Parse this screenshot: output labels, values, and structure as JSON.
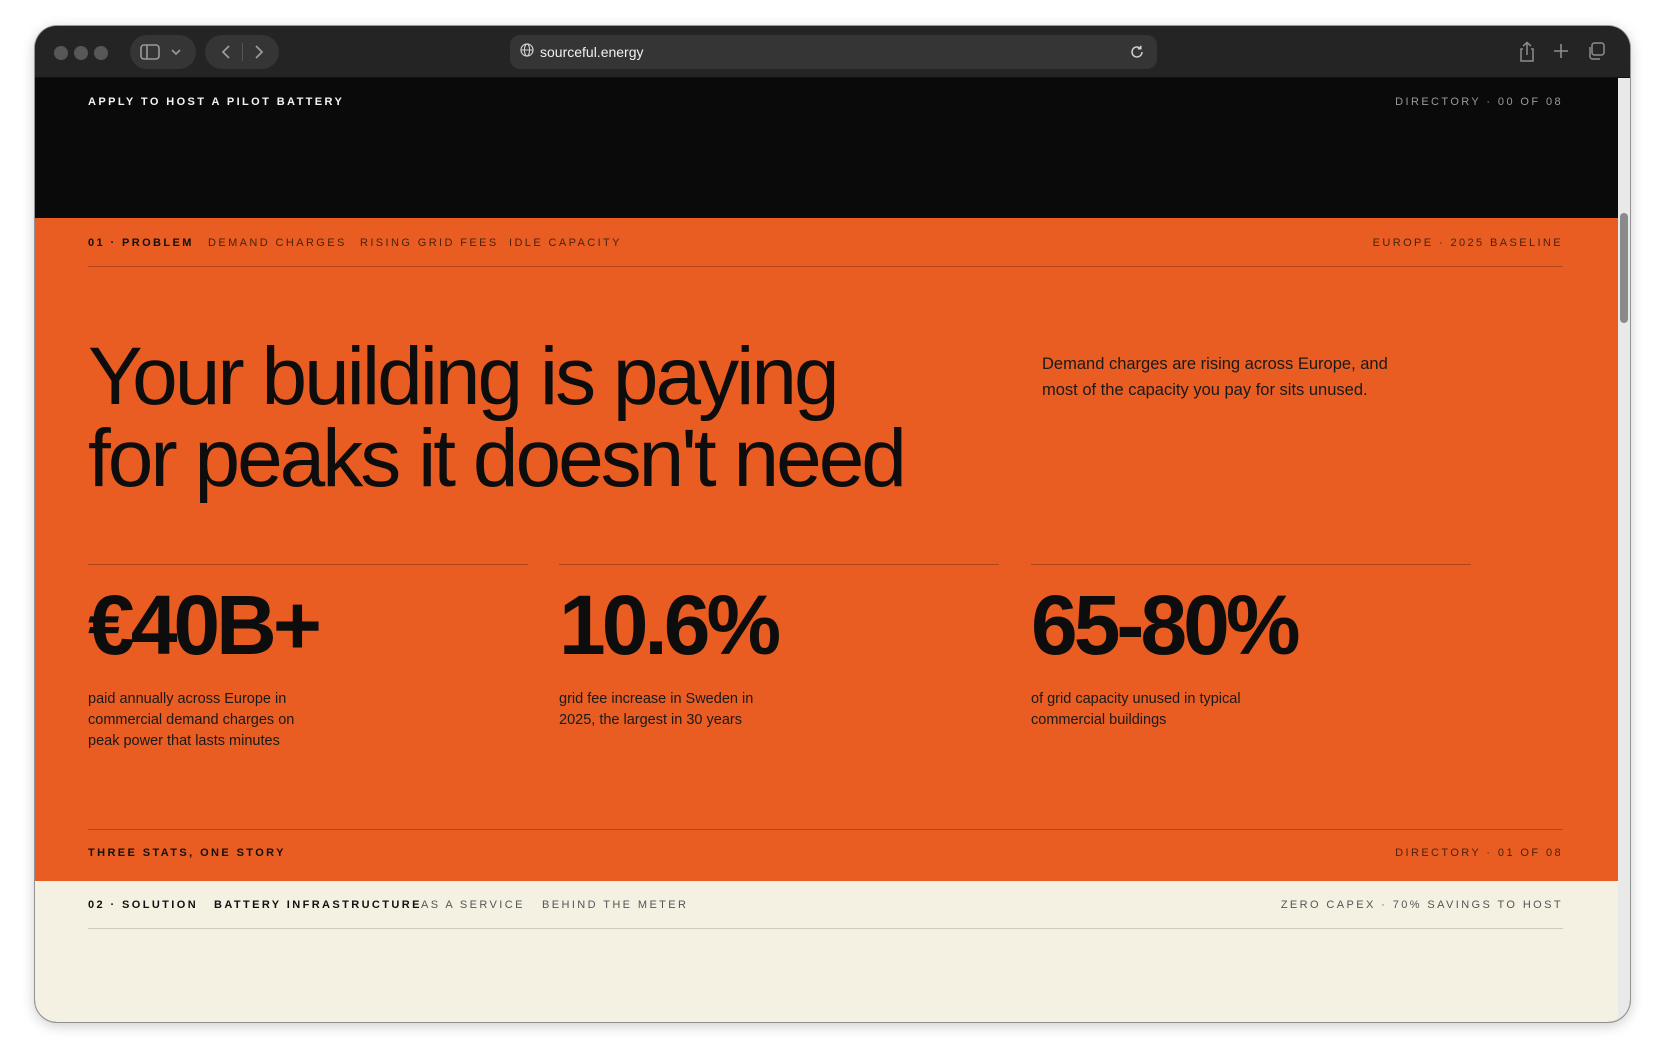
{
  "browser": {
    "url": "sourceful.energy",
    "icons": [
      "sidebar-icon",
      "chevron-down-icon",
      "back-icon",
      "forward-icon",
      "globe-icon",
      "reload-icon",
      "share-icon",
      "plus-icon",
      "tabs-icon"
    ]
  },
  "top_band": {
    "cta": "APPLY TO HOST A PILOT BATTERY",
    "directory": "DIRECTORY · 00 OF 08"
  },
  "problem": {
    "nav": {
      "section": "01 · PROBLEM",
      "items": [
        "DEMAND CHARGES",
        "RISING GRID FEES",
        "IDLE CAPACITY"
      ],
      "right": "EUROPE · 2025 BASELINE"
    },
    "headline_line1": "Your building is paying",
    "headline_line2": "for peaks it doesn't need",
    "intro": "Demand charges are rising across Europe, and most of the capacity you pay for sits unused.",
    "stats": [
      {
        "value": "€40B+",
        "description": "paid annually across Europe in commercial demand charges on peak power that lasts minutes"
      },
      {
        "value": "10.6%",
        "description": "grid fee increase in Sweden in 2025, the largest in 30 years"
      },
      {
        "value": "65-80%",
        "description": "of grid capacity unused in typical commercial buildings"
      }
    ],
    "footer_left": "THREE STATS, ONE STORY",
    "footer_right": "DIRECTORY · 01 OF 08"
  },
  "solution": {
    "nav": {
      "section": "02 · SOLUTION",
      "items": [
        "BATTERY INFRASTRUCTURE",
        "AS A SERVICE",
        "BEHIND THE METER"
      ],
      "right": "ZERO CAPEX · 70% SAVINGS TO HOST"
    }
  },
  "colors": {
    "orange": "#e95c22",
    "black": "#0a0a0a",
    "cream": "#f4f0e2"
  }
}
